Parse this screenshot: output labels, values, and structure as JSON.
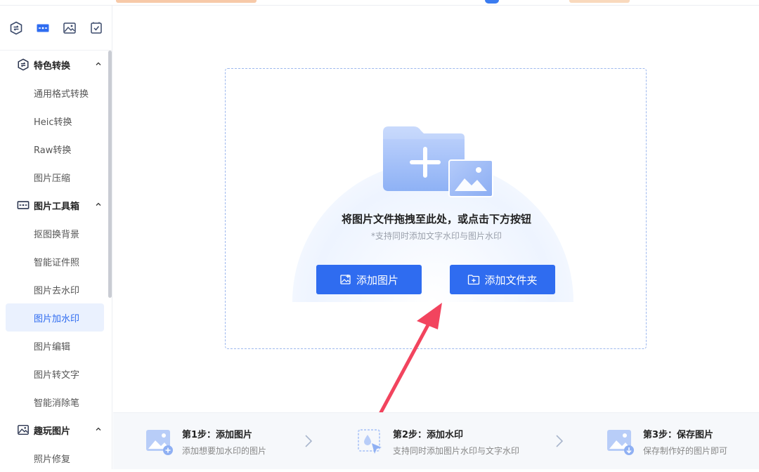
{
  "sidebar": {
    "top_icons": [
      "convert-icon",
      "toolbox-icon",
      "image-fun-icon",
      "checklist-icon"
    ],
    "groups": [
      {
        "label": "特色转换",
        "icon": "convert-icon",
        "items": [
          "通用格式转换",
          "Heic转换",
          "Raw转换",
          "图片压缩"
        ]
      },
      {
        "label": "图片工具箱",
        "icon": "toolbox-icon",
        "items": [
          "抠图换背景",
          "智能证件照",
          "图片去水印",
          "图片加水印",
          "图片编辑",
          "图片转文字",
          "智能消除笔"
        ]
      },
      {
        "label": "趣玩图片",
        "icon": "image-fun-icon",
        "items": [
          "照片修复"
        ]
      }
    ],
    "active_item": "图片加水印"
  },
  "dropzone": {
    "title": "将图片文件拖拽至此处，或点击下方按钮",
    "subtitle": "*支持同时添加文字水印与图片水印",
    "add_image_label": "添加图片",
    "add_folder_label": "添加文件夹"
  },
  "steps": [
    {
      "title": "第1步：添加图片",
      "desc": "添加想要加水印的图片"
    },
    {
      "title": "第2步：添加水印",
      "desc": "支持同时添加图片水印与文字水印"
    },
    {
      "title": "第3步：保存图片",
      "desc": "保存制作好的图片即可"
    }
  ],
  "colors": {
    "accent": "#2f6cf0",
    "active_bg": "#eaf1fe",
    "annotation_arrow": "#f2445e"
  }
}
